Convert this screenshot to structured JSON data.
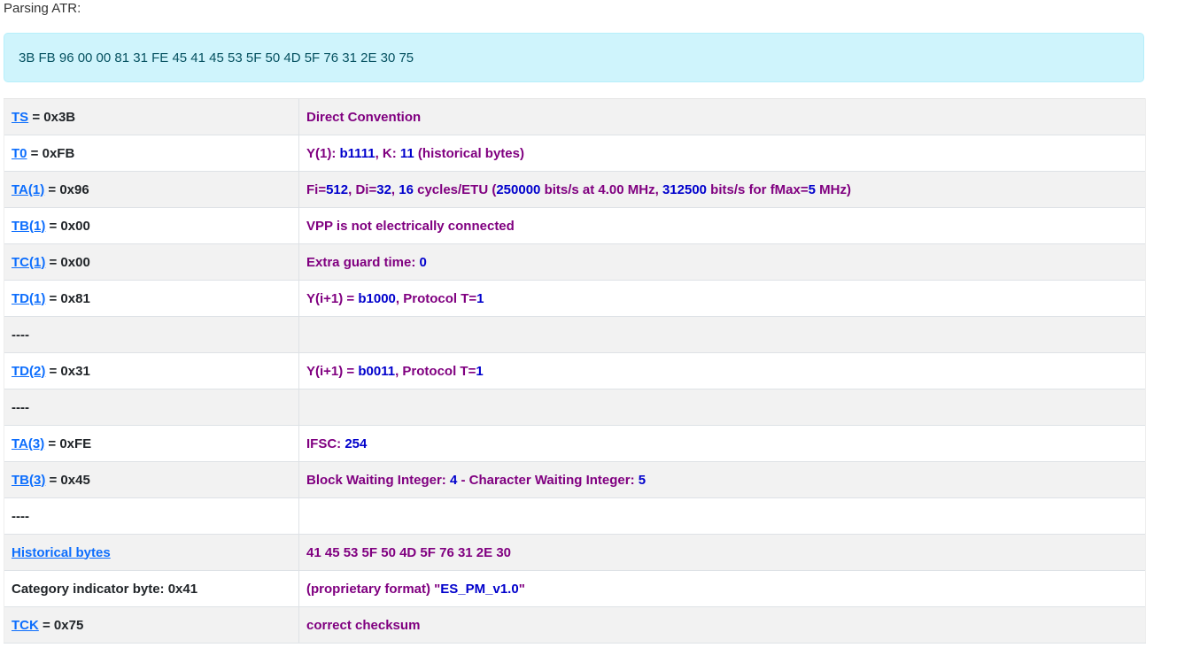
{
  "header": {
    "parsing_label": "Parsing ATR:"
  },
  "atr_hex": "3B FB 96 00 00 81 31 FE 45 41 45 53 5F 50 4D 5F 76 31 2E 30 75",
  "rows": [
    {
      "key": "TS",
      "rest": " = 0x3B",
      "desc": [
        {
          "t": "p",
          "s": "Direct Convention"
        }
      ]
    },
    {
      "key": "T0",
      "rest": " = 0xFB",
      "desc": [
        {
          "t": "p",
          "s": "Y(1): "
        },
        {
          "t": "v",
          "s": "b1111"
        },
        {
          "t": "p",
          "s": ", K: "
        },
        {
          "t": "v",
          "s": "11"
        },
        {
          "t": "p",
          "s": " (historical bytes)"
        }
      ]
    },
    {
      "key": "TA(1)",
      "rest": " = 0x96",
      "desc": [
        {
          "t": "p",
          "s": "Fi="
        },
        {
          "t": "v",
          "s": "512"
        },
        {
          "t": "p",
          "s": ", Di="
        },
        {
          "t": "v",
          "s": "32"
        },
        {
          "t": "p",
          "s": ", "
        },
        {
          "t": "v",
          "s": "16"
        },
        {
          "t": "p",
          "s": " cycles/ETU ("
        },
        {
          "t": "v",
          "s": "250000"
        },
        {
          "t": "p",
          "s": " bits/s at 4.00 MHz, "
        },
        {
          "t": "v",
          "s": "312500"
        },
        {
          "t": "p",
          "s": " bits/s for fMax="
        },
        {
          "t": "v",
          "s": "5"
        },
        {
          "t": "p",
          "s": " MHz)"
        }
      ]
    },
    {
      "key": "TB(1)",
      "rest": " = 0x00",
      "desc": [
        {
          "t": "p",
          "s": "VPP is not electrically connected"
        }
      ]
    },
    {
      "key": "TC(1)",
      "rest": " = 0x00",
      "desc": [
        {
          "t": "p",
          "s": "Extra guard time: "
        },
        {
          "t": "v",
          "s": "0"
        }
      ]
    },
    {
      "key": "TD(1)",
      "rest": " = 0x81",
      "desc": [
        {
          "t": "p",
          "s": "Y(i+1) = "
        },
        {
          "t": "v",
          "s": "b1000"
        },
        {
          "t": "p",
          "s": ", Protocol T="
        },
        {
          "t": "v",
          "s": "1"
        }
      ]
    },
    {
      "key": "",
      "rest": "----",
      "desc": []
    },
    {
      "key": "TD(2)",
      "rest": " = 0x31",
      "desc": [
        {
          "t": "p",
          "s": "Y(i+1) = "
        },
        {
          "t": "v",
          "s": "b0011"
        },
        {
          "t": "p",
          "s": ", Protocol T="
        },
        {
          "t": "v",
          "s": "1"
        }
      ]
    },
    {
      "key": "",
      "rest": "----",
      "desc": []
    },
    {
      "key": "TA(3)",
      "rest": " = 0xFE",
      "desc": [
        {
          "t": "p",
          "s": "IFSC: "
        },
        {
          "t": "v",
          "s": "254"
        }
      ]
    },
    {
      "key": "TB(3)",
      "rest": " = 0x45",
      "desc": [
        {
          "t": "p",
          "s": "Block Waiting Integer: "
        },
        {
          "t": "v",
          "s": "4"
        },
        {
          "t": "p",
          "s": " - Character Waiting Integer: "
        },
        {
          "t": "v",
          "s": "5"
        }
      ]
    },
    {
      "key": "",
      "rest": "----",
      "desc": []
    },
    {
      "key": "Historical bytes",
      "rest": "",
      "desc": [
        {
          "t": "p",
          "s": "41 45 53 5F 50 4D 5F 76 31 2E 30"
        }
      ]
    },
    {
      "key": "",
      "rest": "Category indicator byte: 0x41",
      "desc": [
        {
          "t": "p",
          "s": "(proprietary format) \""
        },
        {
          "t": "v",
          "s": "ES_PM_v1.0"
        },
        {
          "t": "p",
          "s": "\""
        }
      ]
    },
    {
      "key": "TCK",
      "rest": " = 0x75",
      "desc": [
        {
          "t": "p",
          "s": "correct checksum"
        }
      ]
    }
  ],
  "colors": {
    "link": "#0d6efd",
    "description": "#800080",
    "value": "#0000cc",
    "alert_bg": "#cff4fc",
    "stripe": "#f2f2f2"
  }
}
